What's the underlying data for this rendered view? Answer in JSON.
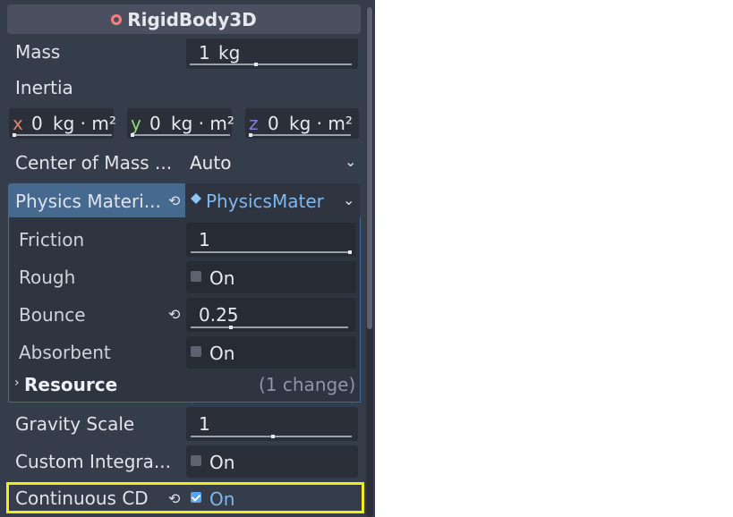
{
  "header": {
    "title": "RigidBody3D",
    "icon": "rigidbody-node-icon"
  },
  "mass": {
    "label": "Mass",
    "value": "1",
    "unit": "kg"
  },
  "inertia": {
    "label": "Inertia",
    "x": {
      "axis": "x",
      "value": "0",
      "unit": "kg · m²"
    },
    "y": {
      "axis": "y",
      "value": "0",
      "unit": "kg · m²"
    },
    "z": {
      "axis": "z",
      "value": "0",
      "unit": "kg · m²"
    }
  },
  "center_of_mass": {
    "label": "Center of Mass ...",
    "value": "Auto"
  },
  "physics_material": {
    "label": "Physics Materi...",
    "value": "PhysicsMater",
    "friction": {
      "label": "Friction",
      "value": "1"
    },
    "rough": {
      "label": "Rough",
      "value": "On",
      "checked": false
    },
    "bounce": {
      "label": "Bounce",
      "value": "0.25"
    },
    "absorbent": {
      "label": "Absorbent",
      "value": "On",
      "checked": false
    },
    "resource": {
      "label": "Resource",
      "changes": "(1 change)"
    }
  },
  "gravity_scale": {
    "label": "Gravity Scale",
    "value": "1"
  },
  "custom_integrator": {
    "label": "Custom Integra...",
    "value": "On",
    "checked": false
  },
  "continuous_cd": {
    "label": "Continuous CD",
    "value": "On",
    "checked": true
  },
  "colors": {
    "highlight": "#f2ea1e",
    "accent": "#5aa3f0",
    "section": "#45698f"
  }
}
